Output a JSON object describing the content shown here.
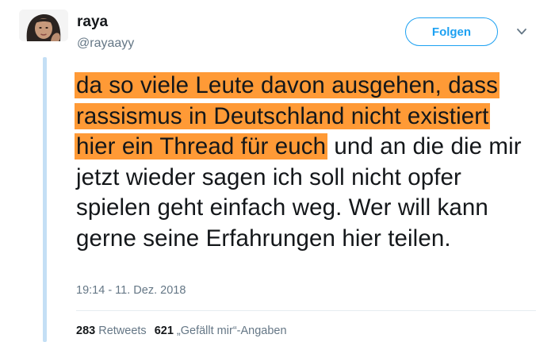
{
  "author": {
    "display_name": "raya",
    "handle": "@rayaayy",
    "avatar_icon": "profile-photo"
  },
  "header": {
    "follow_label": "Folgen",
    "caret_icon": "chevron-down-icon"
  },
  "tweet": {
    "highlighted_lines": [
      "da so viele Leute davon ausgehen, dass",
      "rassismus in Deutschland nicht existiert",
      "hier ein Thread für euch"
    ],
    "rest_text": " und an die die mir jetzt wieder sagen ich soll nicht opfer spielen geht einfach weg. Wer will kann gerne seine Erfahrungen hier teilen.",
    "timestamp": "19:14 - 11. Dez. 2018"
  },
  "stats": {
    "retweets_count": "283",
    "retweets_label": "Retweets",
    "likes_count": "621",
    "likes_label": "„Gefällt mir“-Angaben"
  },
  "colors": {
    "highlight": "#ff9a36",
    "accent": "#1da1f2",
    "thread_line": "#c4dff5",
    "secondary_text": "#657786"
  }
}
